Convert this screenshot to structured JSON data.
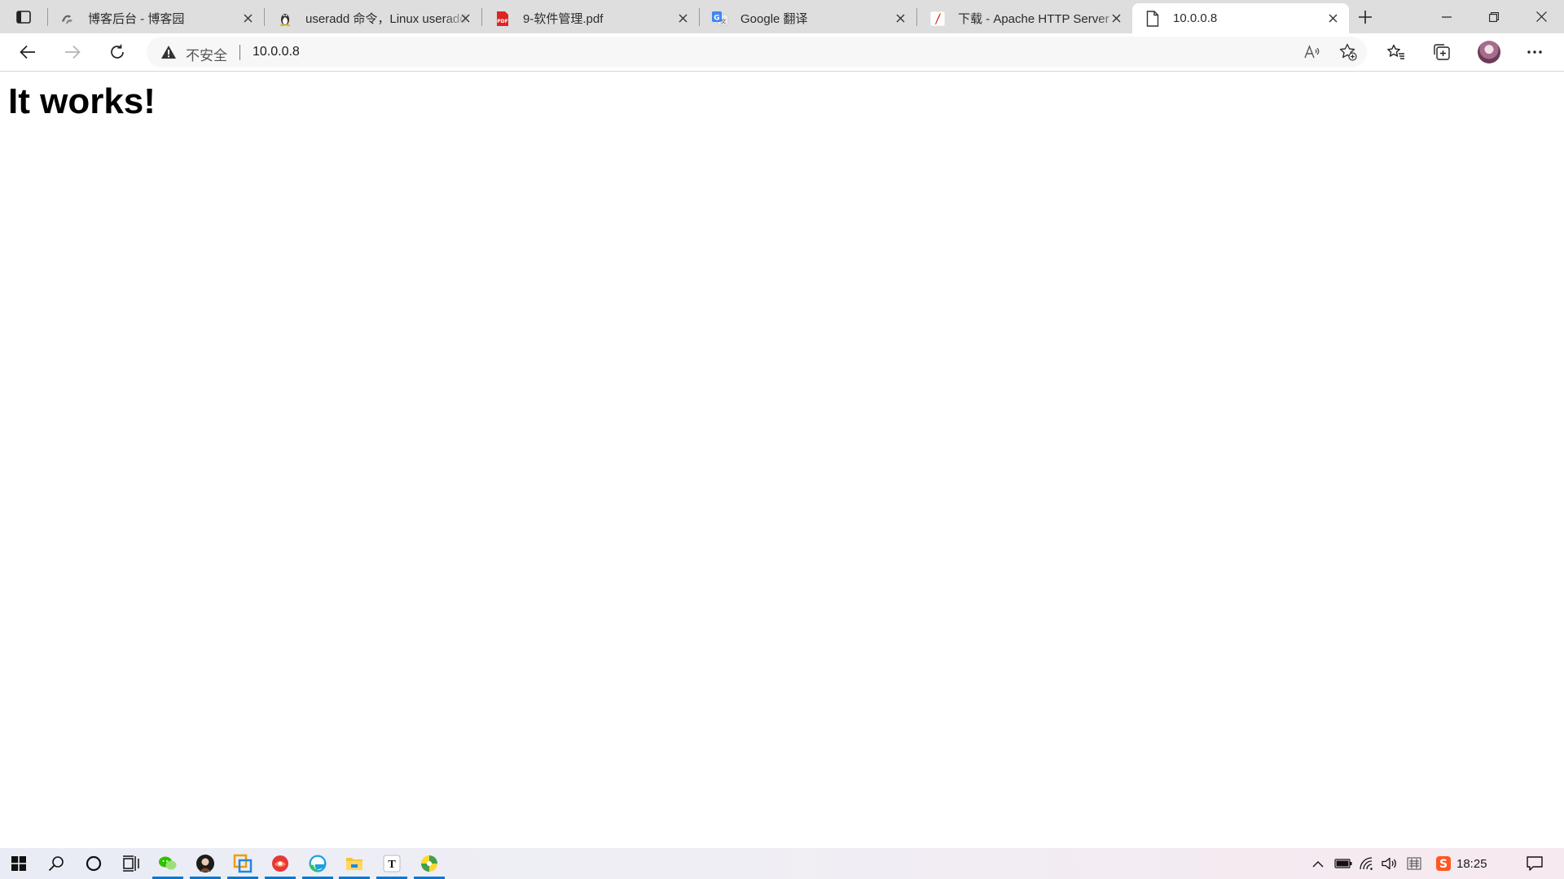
{
  "tabs": [
    {
      "title": "博客后台 - 博客园",
      "favicon": "cnblogs-icon",
      "active": false
    },
    {
      "title": "useradd 命令，Linux useradd 命令详解",
      "favicon": "tux-linux-icon",
      "active": false
    },
    {
      "title": "9-软件管理.pdf",
      "favicon": "pdf-icon",
      "active": false
    },
    {
      "title": "Google 翻译",
      "favicon": "google-translate-icon",
      "active": false
    },
    {
      "title": "下载 - Apache HTTP Server",
      "favicon": "apache-feather-icon",
      "active": false
    },
    {
      "title": "10.0.0.8",
      "favicon": "page-icon",
      "active": true
    }
  ],
  "address": {
    "security_label": "不安全",
    "url": "10.0.0.8"
  },
  "page": {
    "heading": "It works!"
  },
  "taskbar": {
    "clock": "18:25",
    "pinned": [
      {
        "name": "wechat-icon",
        "running": true
      },
      {
        "name": "avatar-app-icon",
        "running": true
      },
      {
        "name": "virtual-machine-icon",
        "running": true
      },
      {
        "name": "red-app-icon",
        "running": true
      },
      {
        "name": "edge-icon",
        "running": true
      },
      {
        "name": "file-explorer-icon",
        "running": true
      },
      {
        "name": "typora-icon",
        "running": true
      },
      {
        "name": "green-yellow-app-icon",
        "running": true
      }
    ]
  },
  "colors": {
    "tabstrip_bg": "#dedede",
    "accent": "#0078d4",
    "page_bg": "#ffffff"
  }
}
